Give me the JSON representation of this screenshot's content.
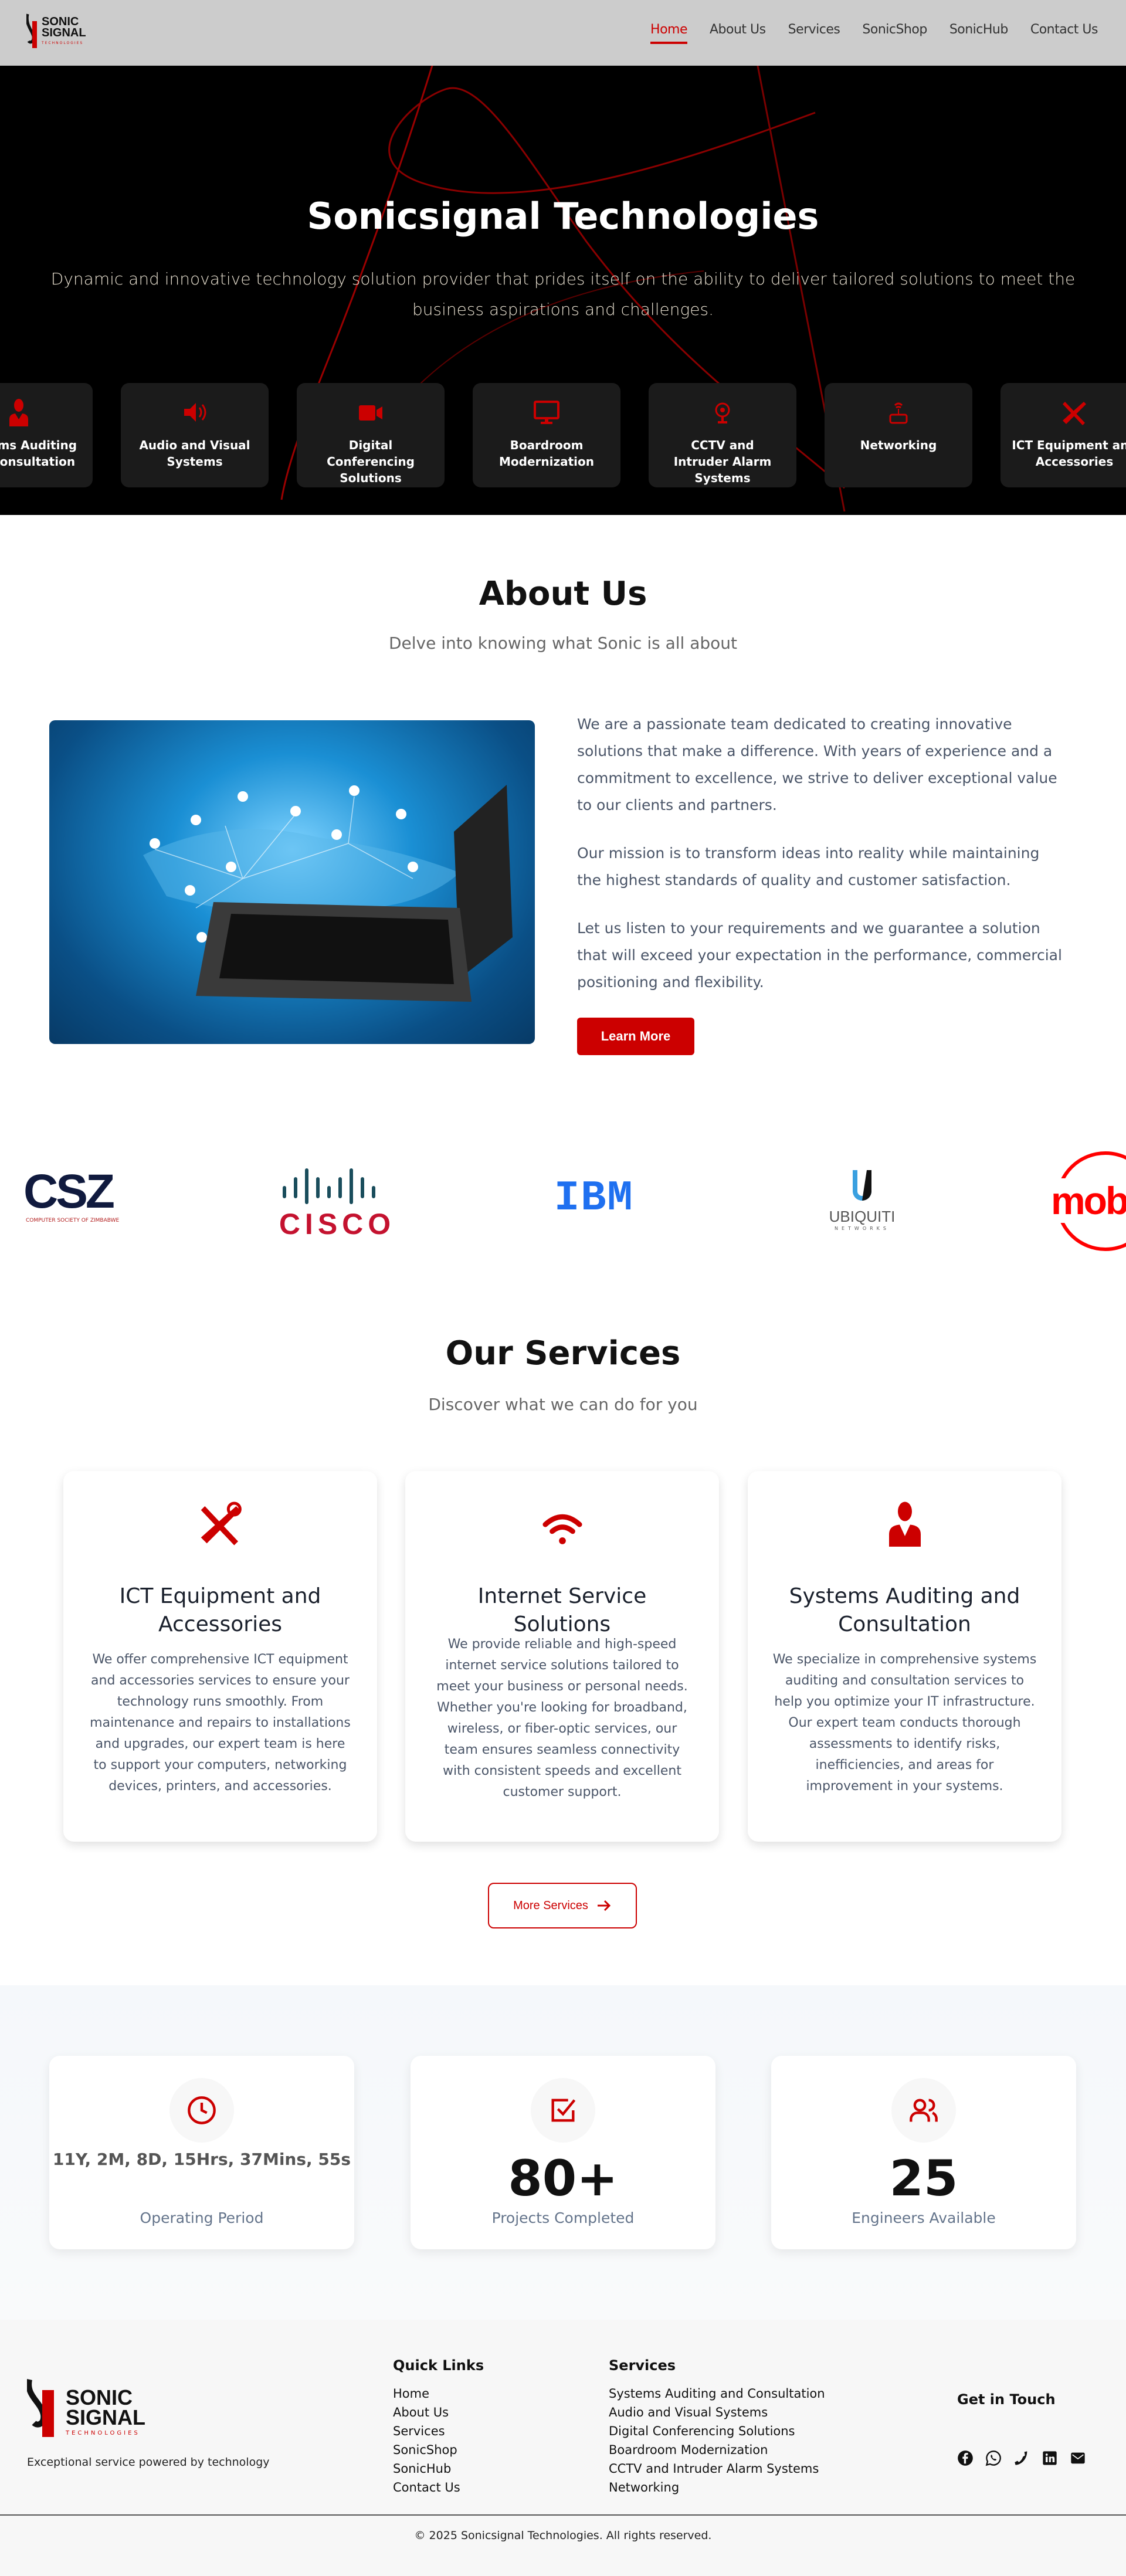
{
  "header": {
    "logo_text": [
      "SONIC",
      "SIGNAL",
      "TECHNOLOGIES"
    ],
    "nav": [
      "Home",
      "About Us",
      "Services",
      "SonicShop",
      "SonicHub",
      "Contact Us"
    ],
    "active": "Home"
  },
  "hero": {
    "title": "Sonicsignal Technologies",
    "subtitle": "Dynamic and innovative technology solution provider that prides itself on the ability to deliver tailored solutions to meet the business aspirations and challenges.",
    "cards": [
      "Systems Auditing and Consultation",
      "Audio and Visual Systems",
      "Digital Conferencing Solutions",
      "Boardroom Modernization",
      "CCTV and Intruder Alarm Systems",
      "Networking",
      "ICT Equipment and Accessories"
    ]
  },
  "about": {
    "title": "About Us",
    "subtitle": "Delve into knowing what Sonic is all about",
    "paragraphs": [
      "We are a passionate team dedicated to creating innovative solutions that make a difference. With years of experience and a commitment to excellence, we strive to deliver exceptional value to our clients and partners.",
      "Our mission is to transform ideas into reality while maintaining the highest standards of quality and customer satisfaction.",
      "Let us listen to your requirements and we guarantee a solution that will exceed your expectation in the performance, commercial positioning and flexibility."
    ],
    "button": "Learn More"
  },
  "partners": [
    "CSZ",
    "COMPUTER SOCIETY OF ZIMBABWE",
    "CISCO",
    "IBM",
    "UBIQUITI",
    "NETWORKS",
    "mob"
  ],
  "services": {
    "title": "Our Services",
    "subtitle": "Discover what we can do for you",
    "cards": [
      {
        "title": "ICT Equipment and Accessories",
        "desc": "We offer comprehensive ICT equipment and accessories services to ensure your technology runs smoothly. From maintenance and repairs to installations and upgrades, our expert team is here to support your computers, networking devices, printers, and accessories."
      },
      {
        "title": "Internet Service Solutions",
        "desc": "We provide reliable and high-speed internet service solutions tailored to meet your business or personal needs. Whether you're looking for broadband, wireless, or fiber-optic services, our team ensures seamless connectivity with consistent speeds and excellent customer support."
      },
      {
        "title": "Systems Auditing and Consultation",
        "desc": "We specialize in comprehensive systems auditing and consultation services to help you optimize your IT infrastructure. Our expert team conducts thorough assessments to identify risks, inefficiencies, and areas for improvement in your systems."
      }
    ],
    "more": "More Services"
  },
  "stats": [
    {
      "value": "11Y, 2M, 8D, 15Hrs, 37Mins, 55s",
      "label": "Operating Period"
    },
    {
      "value": "80+",
      "label": "Projects Completed"
    },
    {
      "value": "25",
      "label": "Engineers Available"
    }
  ],
  "footer": {
    "tagline": "Exceptional service powered by technology",
    "quick_title": "Quick Links",
    "quick": [
      "Home",
      "About Us",
      "Services",
      "SonicShop",
      "SonicHub",
      "Contact Us"
    ],
    "services_title": "Services",
    "services": [
      "Systems Auditing and Consultation",
      "Audio and Visual Systems",
      "Digital Conferencing Solutions",
      "Boardroom Modernization",
      "CCTV and Intruder Alarm Systems",
      "Networking"
    ],
    "contact_title": "Get in Touch",
    "copyright": "© 2025 Sonicsignal Technologies. All rights reserved."
  },
  "colors": {
    "accent": "#cc0000",
    "header": "#cccccc"
  }
}
